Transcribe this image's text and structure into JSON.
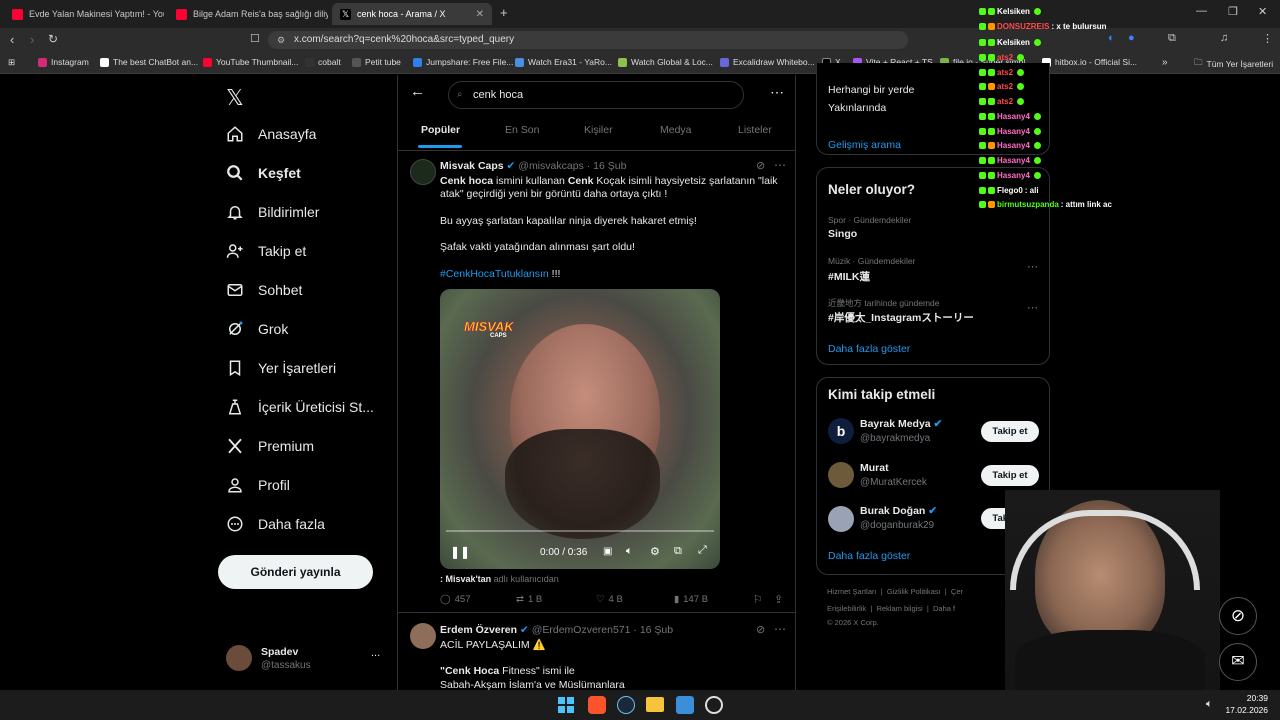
{
  "browser": {
    "tabs": [
      {
        "title": "Evde Yalan Makinesi Yaptım! - YouTube",
        "color": "#ff0033"
      },
      {
        "title": "Bilge Adam Reis'a baş sağlığı diliyoruz",
        "color": "#ff0033"
      },
      {
        "title": "cenk hoca - Arama / X",
        "color": "#ffffff"
      }
    ],
    "url": "x.com/search?q=cenk%20hoca&src=typed_query",
    "bookmarks": [
      "Instagram",
      "The best ChatBot an...",
      "YouTube Thumbnail...",
      "cobalt",
      "Petit tube",
      "Jumpshare: Free File...",
      "Watch Era31 - YaRo...",
      "Watch Global & Loc...",
      "Excalidraw Whitebo...",
      "X",
      "Vite + React + TS",
      "file.io - Super simpl...",
      "hitbox.io - Official Si...",
      "»",
      "Tüm Yer İşaretleri"
    ]
  },
  "sidebar": {
    "items": [
      {
        "label": "Anasayfa"
      },
      {
        "label": "Keşfet"
      },
      {
        "label": "Bildirimler"
      },
      {
        "label": "Takip et"
      },
      {
        "label": "Sohbet"
      },
      {
        "label": "Grok"
      },
      {
        "label": "Yer İşaretleri"
      },
      {
        "label": "İçerik Üreticisi St..."
      },
      {
        "label": "Premium"
      },
      {
        "label": "Profil"
      },
      {
        "label": "Daha fazla"
      }
    ],
    "post_button": "Gönderi yayınla",
    "account": {
      "name": "Spadev",
      "handle": "@tassakus",
      "more": "..."
    }
  },
  "search": {
    "query": "cenk hoca",
    "tabs": [
      "Popüler",
      "En Son",
      "Kişiler",
      "Medya",
      "Listeler"
    ]
  },
  "tweet1": {
    "name": "Misvak Caps",
    "handle": "@misvakcaps",
    "date": "· 16 Şub",
    "line1_bold": "Cenk hoca",
    "line1_rest": " ismini kullanan ",
    "line1_bold2": "Cenk",
    "line1_rest2": " Koçak isimli haysiyetsiz şarlatanın \"laik atak\" geçirdiği yeni bir görüntü daha ortaya çıktı !",
    "para2": "Bu ayyaş şarlatan kapalılar ninja diyerek hakaret etmiş!",
    "para3": "Şafak vakti yatağından alınması şart oldu!",
    "hashtag": "#CenkHocaTutuklansın",
    "hashtag_suffix": " !!!",
    "video_logo": "MISVAK",
    "video_logo_sub": "CAPS",
    "video_time": "0:00 / 0:36",
    "video_progress": 0,
    "caption_user": ": Misvak'tan",
    "caption_rest": " adlı kullanıcıdan",
    "replies": "457",
    "reposts": "1 B",
    "likes": "4 B",
    "views": "147 B"
  },
  "tweet2": {
    "name": "Erdem Özveren",
    "handle": "@ErdemOzveren571",
    "date": "· 16 Şub",
    "line1": "ACİL PAYLAŞALIM ⚠️",
    "line2_bold": "\"Cenk Hoca",
    "line2_rest": " Fitness\" ismi ile",
    "line3": "Sabah-Akşam İslam'a ve Müslümanlara"
  },
  "right": {
    "location_opts": [
      "Herhangi bir yerde",
      "Yakınlarında"
    ],
    "advanced": "Gelişmiş arama",
    "trends_title": "Neler oluyor?",
    "trends": [
      {
        "context": "Spor · Gündemdekiler",
        "name": "Singo"
      },
      {
        "context": "Müzik · Gündemdekiler",
        "name": "#MILK蓮"
      },
      {
        "context": "近畿地方 tarihinde gündemde",
        "name": "#岸優太_Instagramストーリー"
      }
    ],
    "trends_more": "Daha fazla göster",
    "who_title": "Kimi takip etmeli",
    "who": [
      {
        "name": "Bayrak Medya",
        "handle": "@bayrakmedya",
        "verified": true
      },
      {
        "name": "Murat",
        "handle": "@MuratKercek",
        "verified": false
      },
      {
        "name": "Burak Doğan",
        "handle": "@doganburak29",
        "verified": true
      }
    ],
    "follow_label": "Takip et",
    "who_more": "Daha fazla göster",
    "footer1": "Hizmet Şartları  |  Gizlilik Politikası  |  Çer",
    "footer2": "Erişilebilirlik  |  Reklam bilgisi  |  Daha f",
    "footer3": "© 2026 X Corp."
  },
  "chat": [
    {
      "user": "Kelsiken",
      "msg": "",
      "color": "#ffffff"
    },
    {
      "user": "DONSUZREIS",
      "msg": ": x te bulursun",
      "color": "#ff4b4b"
    },
    {
      "user": "Kelsiken",
      "msg": "",
      "color": "#ffffff"
    },
    {
      "user": "ats2",
      "msg": "",
      "color": "#ff4b4b"
    },
    {
      "user": "ats2",
      "msg": "",
      "color": "#ff4b4b"
    },
    {
      "user": "ats2",
      "msg": "",
      "color": "#ff4b4b"
    },
    {
      "user": "ats2",
      "msg": "",
      "color": "#ff4b4b"
    },
    {
      "user": "Hasany4",
      "msg": "",
      "color": "#ff6ec7"
    },
    {
      "user": "Hasany4",
      "msg": "",
      "color": "#ff6ec7"
    },
    {
      "user": "Hasany4",
      "msg": "",
      "color": "#ff6ec7"
    },
    {
      "user": "Hasany4",
      "msg": "",
      "color": "#ff6ec7"
    },
    {
      "user": "Hasany4",
      "msg": "",
      "color": "#ff6ec7"
    },
    {
      "user": "Flego0",
      "msg": ": ali",
      "color": "#ffffff"
    },
    {
      "user": "birmutsuzpanda",
      "msg": ": attım link ac",
      "color": "#53fc18"
    }
  ],
  "clock": {
    "time": "20:39",
    "date": "17.02.2026"
  }
}
